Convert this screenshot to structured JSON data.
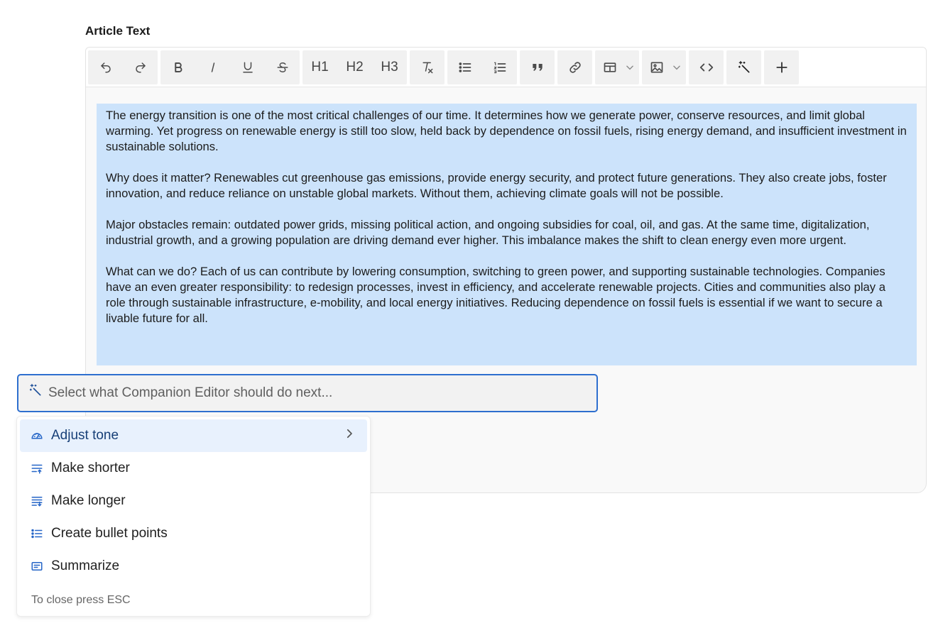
{
  "field": {
    "label": "Article Text"
  },
  "toolbar": {
    "h1": "H1",
    "h2": "H2",
    "h3": "H3"
  },
  "content": {
    "paragraphs": [
      "The energy transition is one of the most critical challenges of our time. It determines how we generate power, conserve resources, and limit global warming. Yet progress on renewable energy is still too slow, held back by dependence on fossil fuels, rising energy demand, and insufficient investment in sustainable solutions.",
      "Why does it matter? Renewables cut greenhouse gas emissions, provide energy security, and protect future generations. They also create jobs, foster innovation, and reduce reliance on unstable global markets. Without them, achieving climate goals will not be possible.",
      "Major obstacles remain: outdated power grids, missing political action, and ongoing subsidies for coal, oil, and gas. At the same time, digitalization, industrial growth, and a growing population are driving demand ever higher. This imbalance makes the shift to clean energy even more urgent.",
      "What can we do? Each of us can contribute by lowering consumption, switching to green power, and supporting sustainable technologies. Companies have an even greater responsibility: to redesign processes, invest in efficiency, and accelerate renewable projects. Cities and communities also play a role through sustainable infrastructure, e-mobility, and local energy initiatives. Reducing dependence on fossil fuels is essential if we want to secure a livable future for all."
    ]
  },
  "ai": {
    "placeholder": "Select what Companion Editor should do next...",
    "menu": [
      {
        "label": "Adjust tone",
        "icon": "gauge-icon"
      },
      {
        "label": "Make shorter",
        "icon": "lines-shorter-icon"
      },
      {
        "label": "Make longer",
        "icon": "lines-longer-icon"
      },
      {
        "label": "Create bullet points",
        "icon": "bullet-list-icon"
      },
      {
        "label": "Summarize",
        "icon": "summary-card-icon"
      }
    ],
    "footer": "To close press ESC"
  },
  "colors": {
    "selection": "#cce3fb",
    "accent": "#2565c7",
    "focus_border": "#2e6fcf",
    "active_item_bg": "#e8f1fd"
  }
}
